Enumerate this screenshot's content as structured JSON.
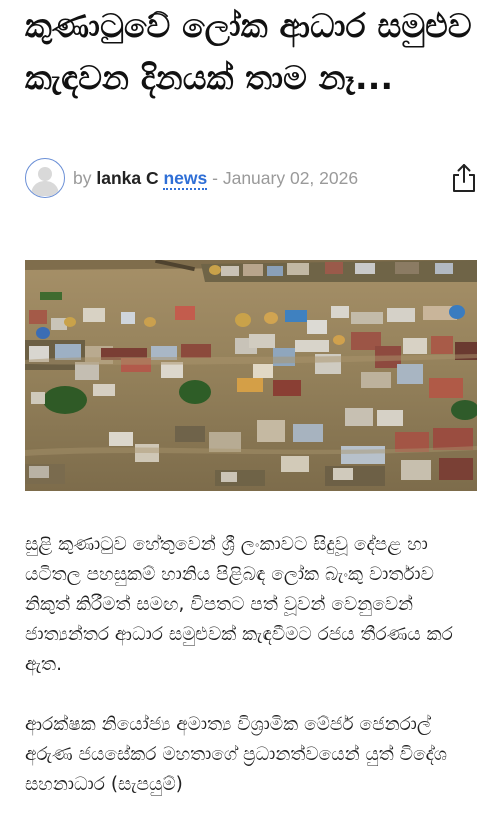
{
  "article": {
    "title": "කුණාටුවේ ලෝක ආධාර සමුළුව කැඳවන දිනයක් තාම නෑ...",
    "byline_prefix": "by",
    "author_name": "lanka C",
    "author_news": "news",
    "separator": "-",
    "date": "January 02, 2026",
    "paragraphs": [
      " සුළි කුණාටුව හේතුවෙන් ශ්‍රී ලංකාවට සිදුවූ දේපළ හා යටිතල පහසුකම් හානිය පිළිබඳ ලෝක බැංකු වාර්තාව නිකුත් කිරීමත් සමඟ, විපතට පත් වූවන් වෙනුවෙන් ජාත්‍යන්තර ආධාර සමුළුවක් කැඳවීමට රජය තීරණය කර ඇත.",
      "ආරක්ෂක නියෝජ්‍ය අමාත්‍ය විශ්‍රාමික මේජර් ජෙනරාල් අරුණ ජයසේකර මහතාගේ ප්‍රධානත්වයෙන් යුත් විදේශ සහනාධාර (සැපයුම්)"
    ]
  },
  "icons": {
    "avatar": "default-user-avatar-icon",
    "share": "share-icon"
  },
  "colors": {
    "accent": "#2f6fd6",
    "meta": "#9a9a9a",
    "title": "#111111"
  }
}
